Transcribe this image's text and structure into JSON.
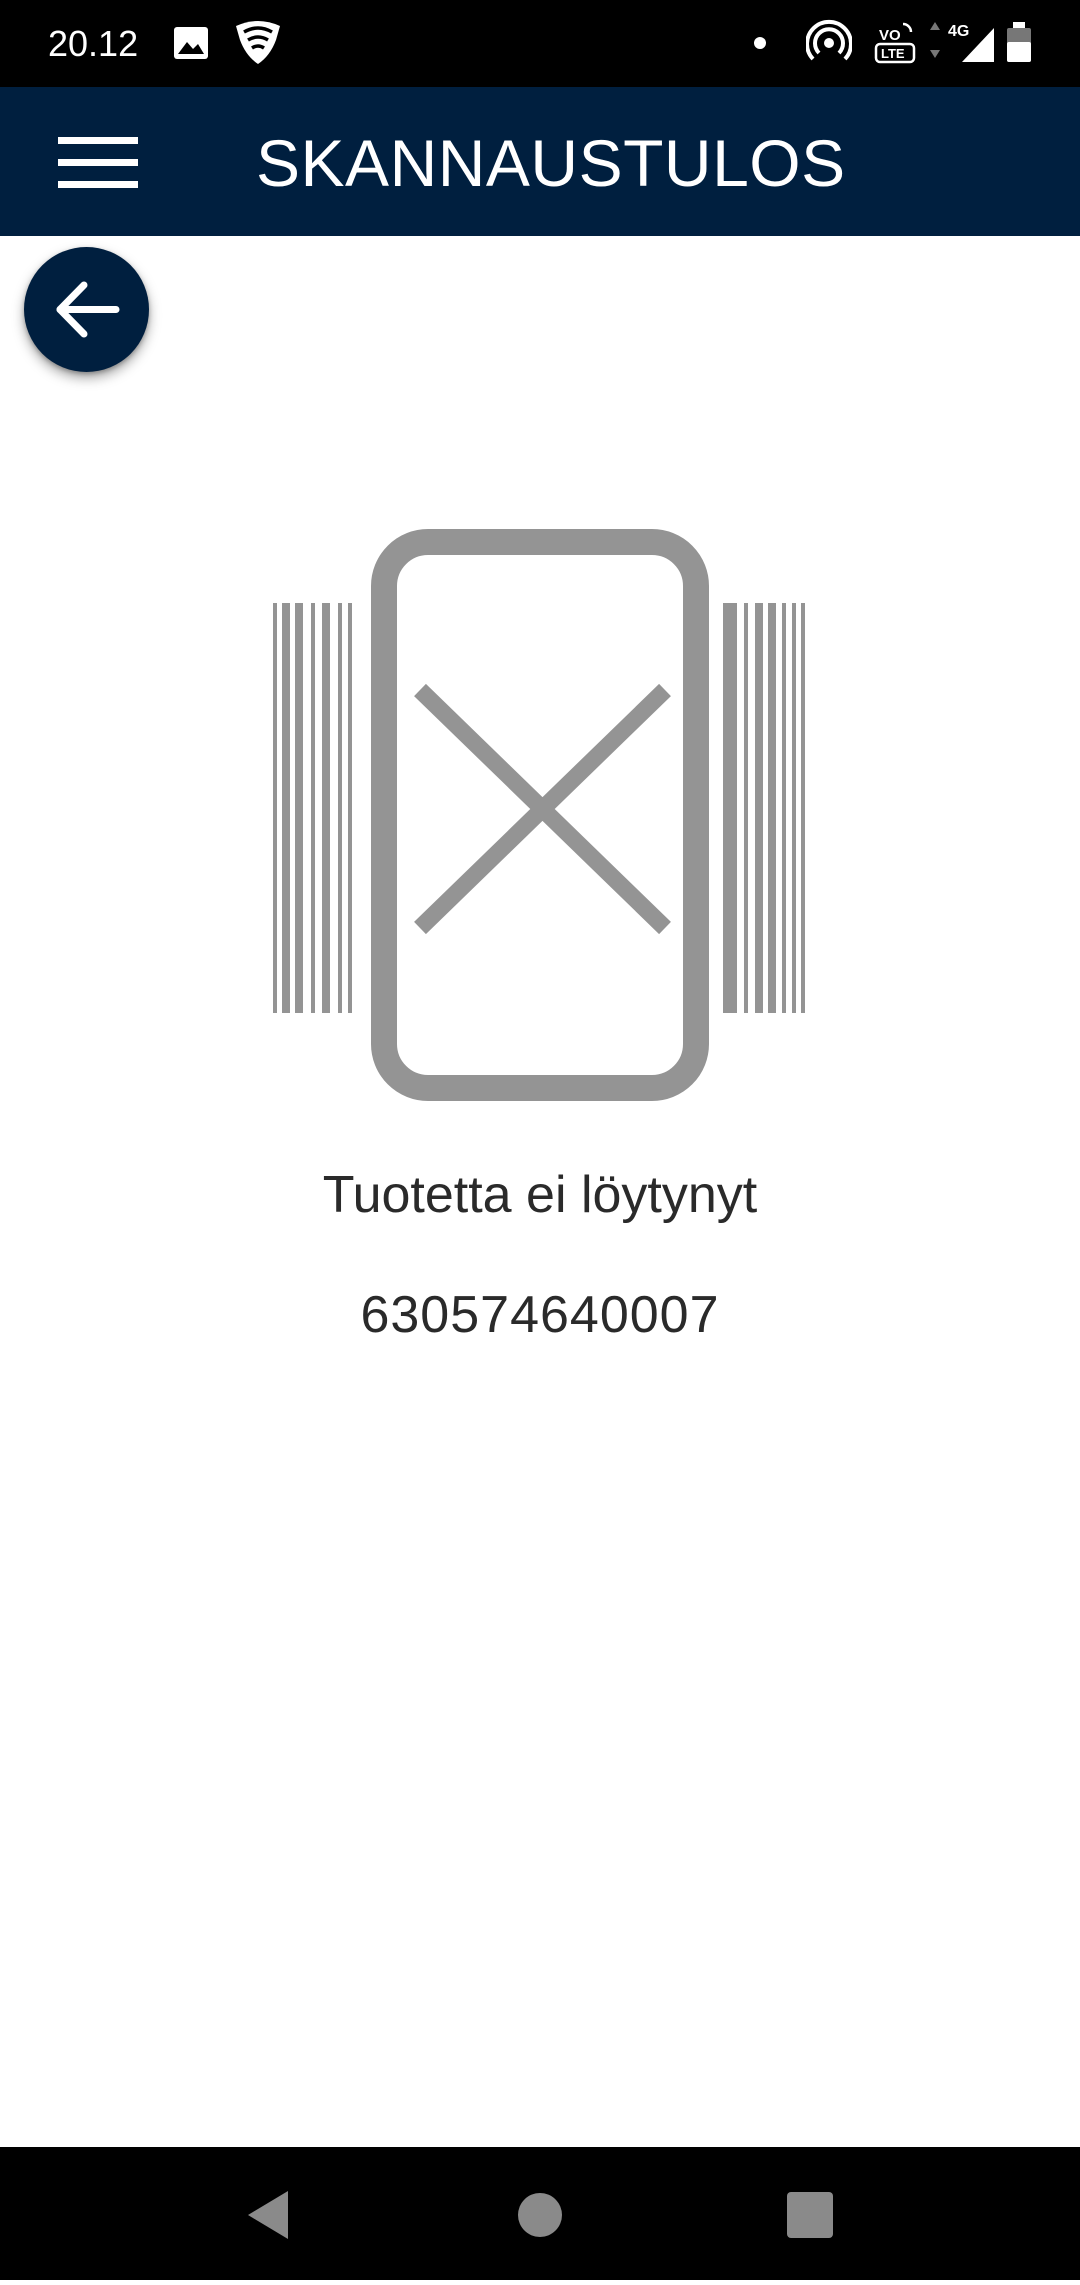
{
  "status_bar": {
    "time": "20.12",
    "icons": [
      "image-icon",
      "shield-wifi-icon",
      "notification-dot-icon",
      "hotspot-icon",
      "volte-icon",
      "4g-signal-icon",
      "battery-icon"
    ],
    "network_label": "4G",
    "volte_label": "VoLTE"
  },
  "app_bar": {
    "title": "SKANNAUSTULOS",
    "menu_icon": "hamburger-menu-icon",
    "background_color": "#001f3f"
  },
  "back_button": {
    "icon": "arrow-left-icon"
  },
  "result": {
    "illustration_icon": "barcode-scan-failed-icon",
    "message": "Tuotetta ei löytynyt",
    "barcode": "630574640007"
  },
  "nav_bar": {
    "icons": [
      "back-triangle-icon",
      "home-circle-icon",
      "recents-square-icon"
    ]
  }
}
